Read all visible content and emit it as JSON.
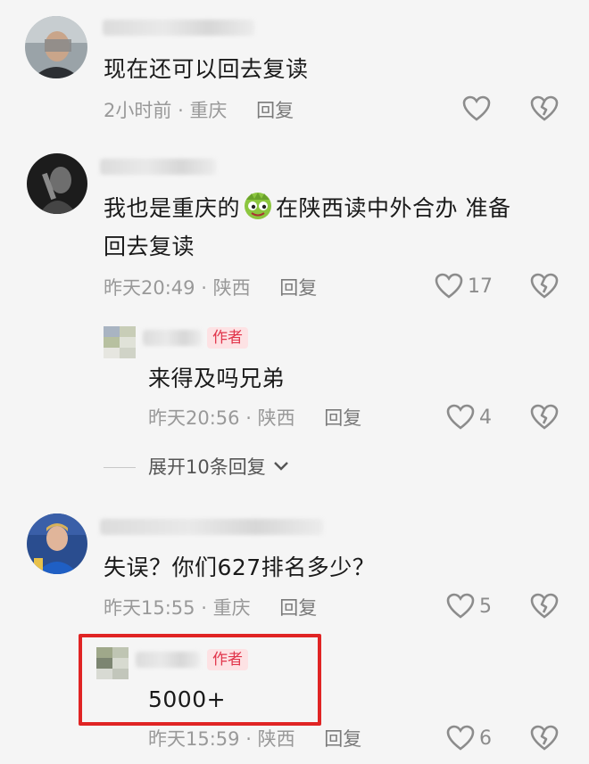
{
  "colors": {
    "accent": "#e1354b",
    "highlight": "#e02424",
    "meta": "#999999"
  },
  "comments": [
    {
      "text": "现在还可以回去复读",
      "time": "2小时前",
      "region": "重庆",
      "reply": "回复",
      "likes": ""
    },
    {
      "text_line1": "我也是重庆的",
      "text_line1b": "在陕西读中外合办 准备",
      "text_line2": "回去复读",
      "time": "昨天20:49",
      "region": "陕西",
      "reply": "回复",
      "likes": "17",
      "emoji": "sly-face-emoji",
      "replies": [
        {
          "badge": "作者",
          "text": "来得及吗兄弟",
          "time": "昨天20:56",
          "region": "陕西",
          "reply": "回复",
          "likes": "4"
        }
      ],
      "expand_label": "展开10条回复"
    },
    {
      "text": "失误？你们627排名多少？",
      "time": "昨天15:55",
      "region": "重庆",
      "reply": "回复",
      "likes": "5",
      "replies": [
        {
          "badge": "作者",
          "text": "5000+",
          "time": "昨天15:59",
          "region": "陕西",
          "reply": "回复",
          "likes": "6"
        }
      ]
    }
  ],
  "separator": "·"
}
